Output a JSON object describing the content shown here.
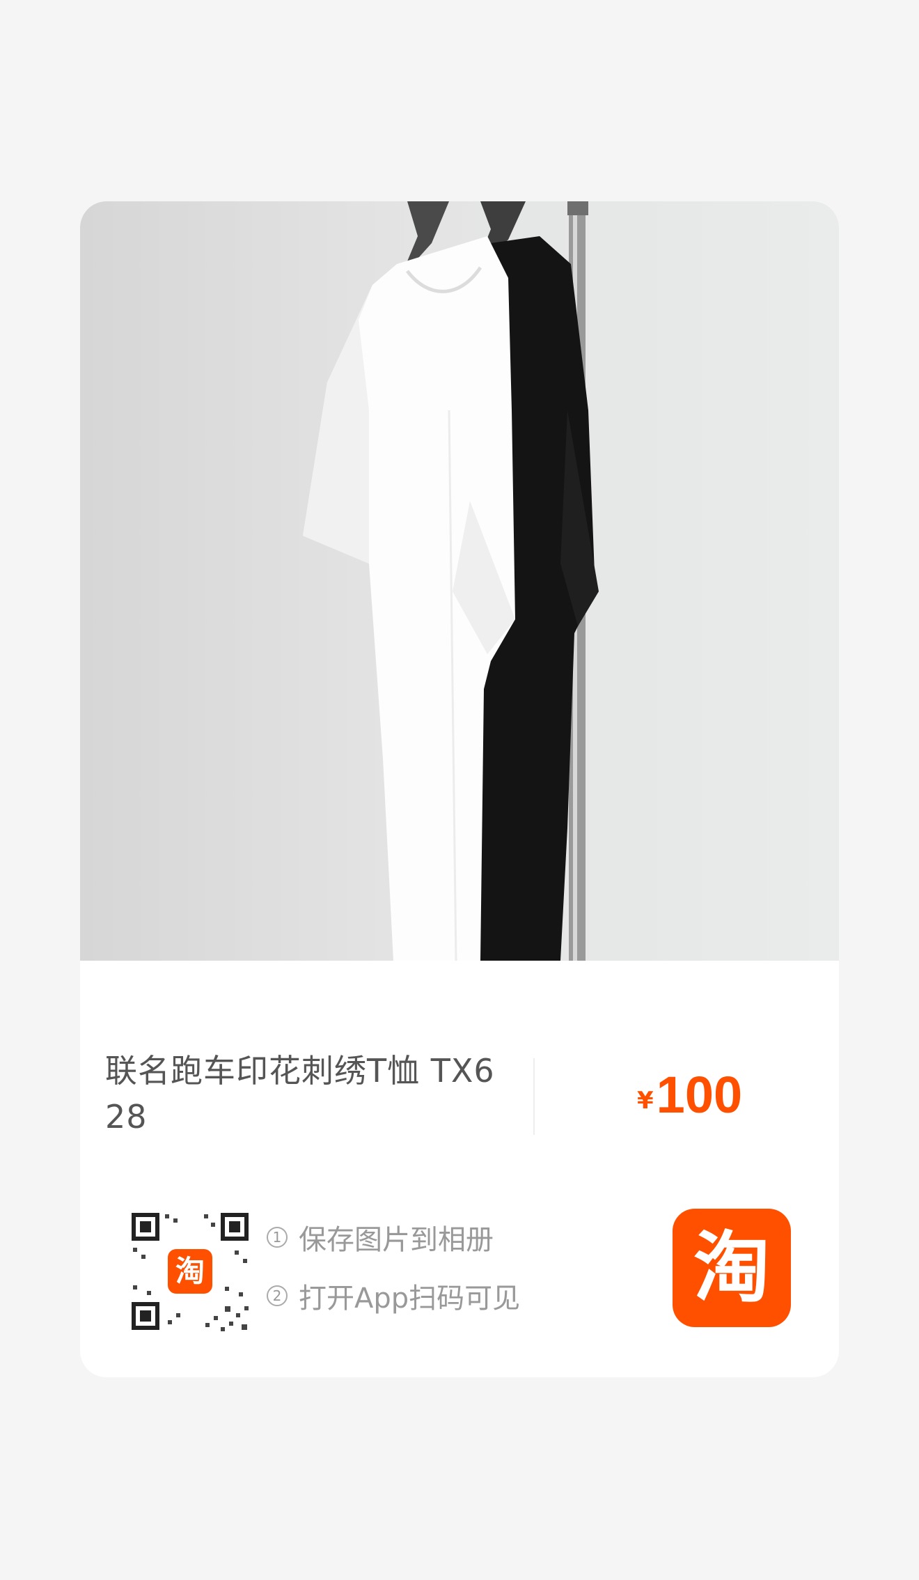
{
  "product": {
    "title": "联名跑车印花刺绣T恤 TX628",
    "price_symbol": "¥",
    "price_value": "100"
  },
  "share": {
    "step1_num": "1",
    "step1_text": "保存图片到相册",
    "step2_num": "2",
    "step2_text": "打开App扫码可见",
    "qr_logo_char": "淘",
    "app_logo_char": "淘"
  },
  "icons": {
    "app_logo": "taobao-icon",
    "qr": "qr-code-icon"
  },
  "colors": {
    "accent": "#ff5000",
    "background": "#f5f5f5",
    "card": "#ffffff"
  }
}
